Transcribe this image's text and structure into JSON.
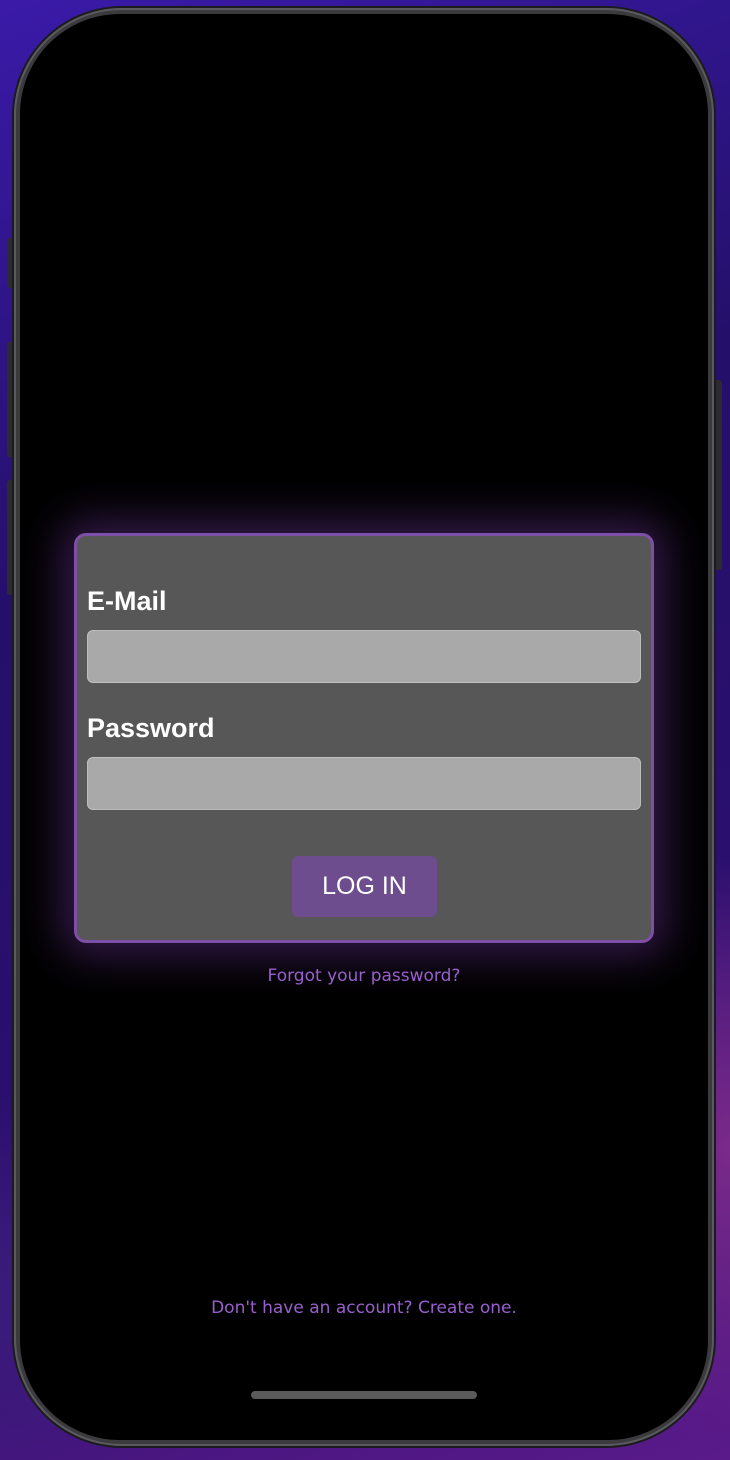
{
  "login_form": {
    "email_label": "E-Mail",
    "email_value": "",
    "password_label": "Password",
    "password_value": "",
    "login_button_label": "LOG IN"
  },
  "links": {
    "forgot_password": "Forgot your password?",
    "create_account": "Don't have an account? Create one."
  },
  "colors": {
    "accent": "#9a5fce",
    "card_background": "#575757",
    "card_border": "#7e4fa6",
    "button_background": "#6d4d8e",
    "input_background": "#a9a9a9"
  }
}
